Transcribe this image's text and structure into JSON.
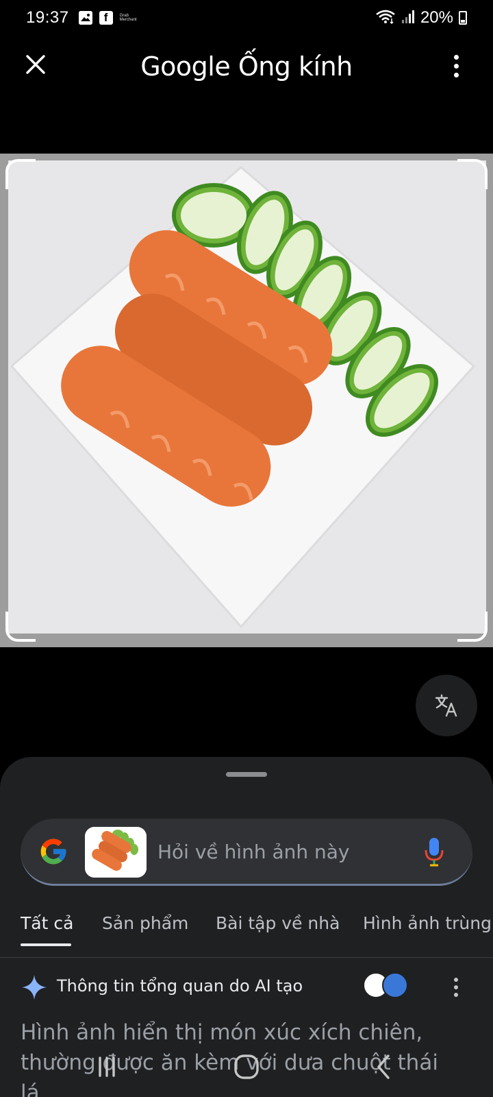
{
  "status_bar": {
    "time": "19:37",
    "tiny_label": "Grab Merchant",
    "battery": "20%",
    "icons": [
      "gallery-icon",
      "facebook-icon",
      "grab-merchant-icon",
      "wifi-icon",
      "signal-icon",
      "battery-icon"
    ]
  },
  "app_bar": {
    "title": "Google Ống kính",
    "close_icon": "close-icon",
    "more_icon": "more-vert-icon"
  },
  "image": {
    "description_icon": "selected-photo",
    "crop_handles": [
      "top-left",
      "top-right",
      "bottom-left",
      "bottom-right"
    ]
  },
  "translate_button": {
    "icon": "translate-icon"
  },
  "search": {
    "placeholder": "Hỏi về hình ảnh này",
    "logo": "google-g-icon",
    "mic_icon": "mic-icon"
  },
  "tabs": [
    {
      "label": "Tất cả",
      "active": true
    },
    {
      "label": "Sản phẩm",
      "active": false
    },
    {
      "label": "Bài tập về nhà",
      "active": false
    },
    {
      "label": "Hình ảnh trùng k",
      "active": false
    }
  ],
  "ai_overview": {
    "title": "Thông tin tổng quan do AI tạo",
    "text_line1": "Hình ảnh hiển thị món xúc xích chiên,",
    "text_line2": "thường được ăn kèm với dưa chuột thái",
    "text_line3": "lá..."
  },
  "colors": {
    "background": "#000000",
    "sheet": "#1f2022",
    "search_bar": "#303134",
    "accent_blue": "#4285f4",
    "text_muted": "#9aa0a6"
  }
}
